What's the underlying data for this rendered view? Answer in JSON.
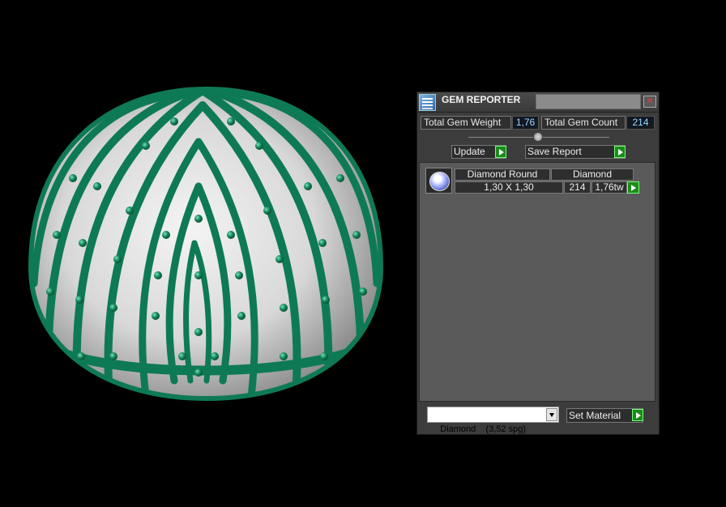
{
  "panel": {
    "title": "GEM REPORTER",
    "close_glyph": "✕",
    "total_weight_label": "Total Gem Weight",
    "total_weight_value": "1,76",
    "total_count_label": "Total Gem Count",
    "total_count_value": "214",
    "update_label": "Update",
    "save_report_label": "Save Report",
    "gems": [
      {
        "name": "Diamond Round",
        "material": "Diamond",
        "size": "1,30 X 1,30",
        "count": "214",
        "weight": "1,76tw"
      }
    ],
    "material_select_value": "Diamond    (3,52 spg)",
    "set_material_label": "Set Material"
  },
  "colors": {
    "metal": "#0e7a55",
    "background": "#000000",
    "accent_go": "#1c8a1c"
  },
  "icons": {
    "app": "gem-reporter-icon",
    "go": "play-arrow-icon",
    "gem": "round-diamond-icon"
  }
}
